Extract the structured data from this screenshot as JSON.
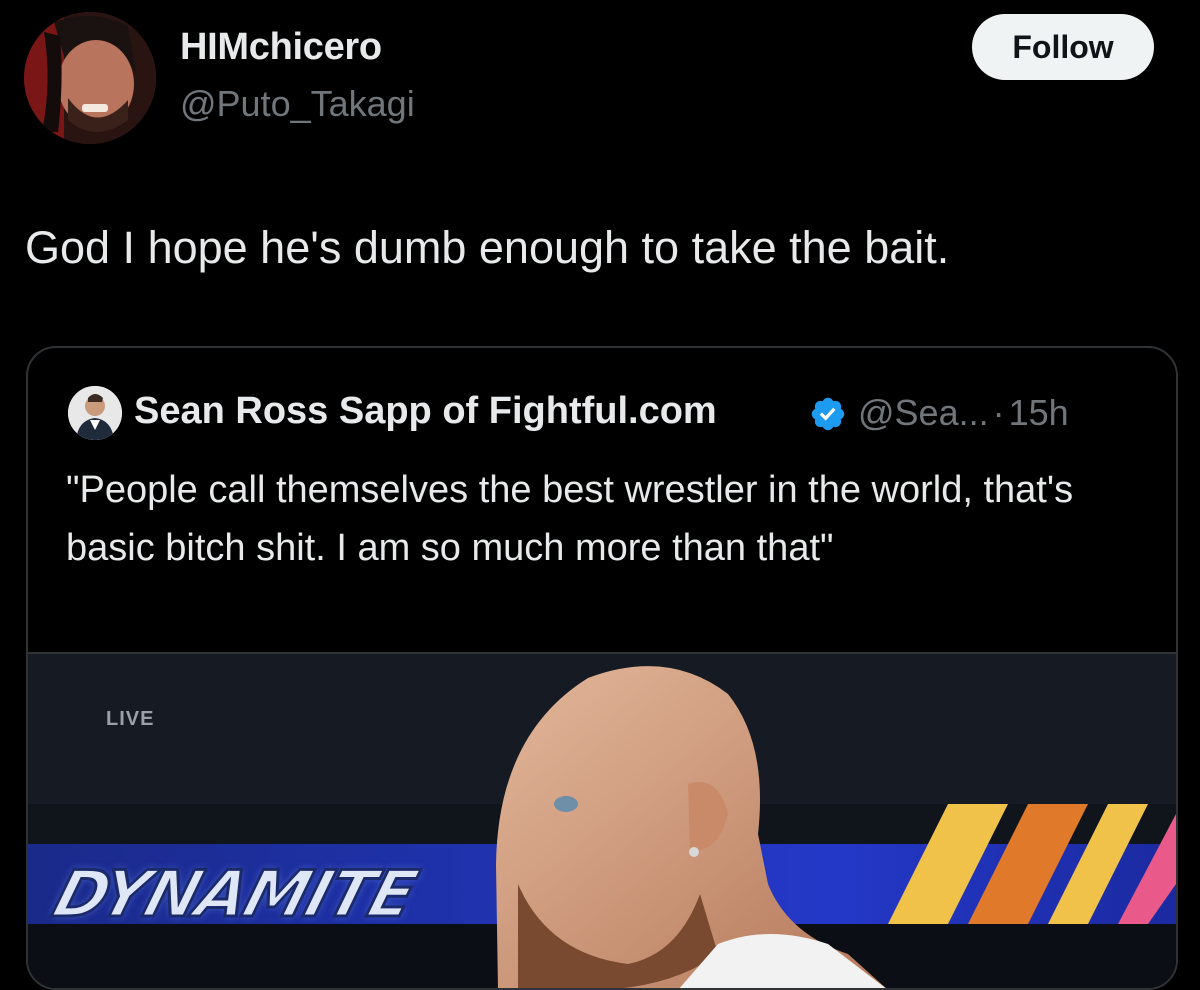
{
  "author": {
    "display_name": "HIMchicero",
    "handle": "@Puto_Takagi",
    "avatar_icon": "profile-photo"
  },
  "follow_button": {
    "label": "Follow"
  },
  "tweet": {
    "text": "God I hope he's dumb enough to take the bait."
  },
  "quoted_tweet": {
    "display_name": "Sean Ross Sapp of Fightful.com",
    "verified": true,
    "verified_color": "#1d9bf0",
    "handle": "@Sea...",
    "separator": "·",
    "time": "15h",
    "text": "\"People call themselves the best wrestler in the world, that's basic bitch shit. I am so much more than that\"",
    "media": {
      "live_label": "LIVE",
      "logo_text": "DYNAMITE"
    }
  },
  "colors": {
    "background": "#000000",
    "primary_text": "#e7e9ea",
    "secondary_text": "#71767b",
    "border": "#2f3336",
    "follow_bg": "#eff3f4"
  }
}
